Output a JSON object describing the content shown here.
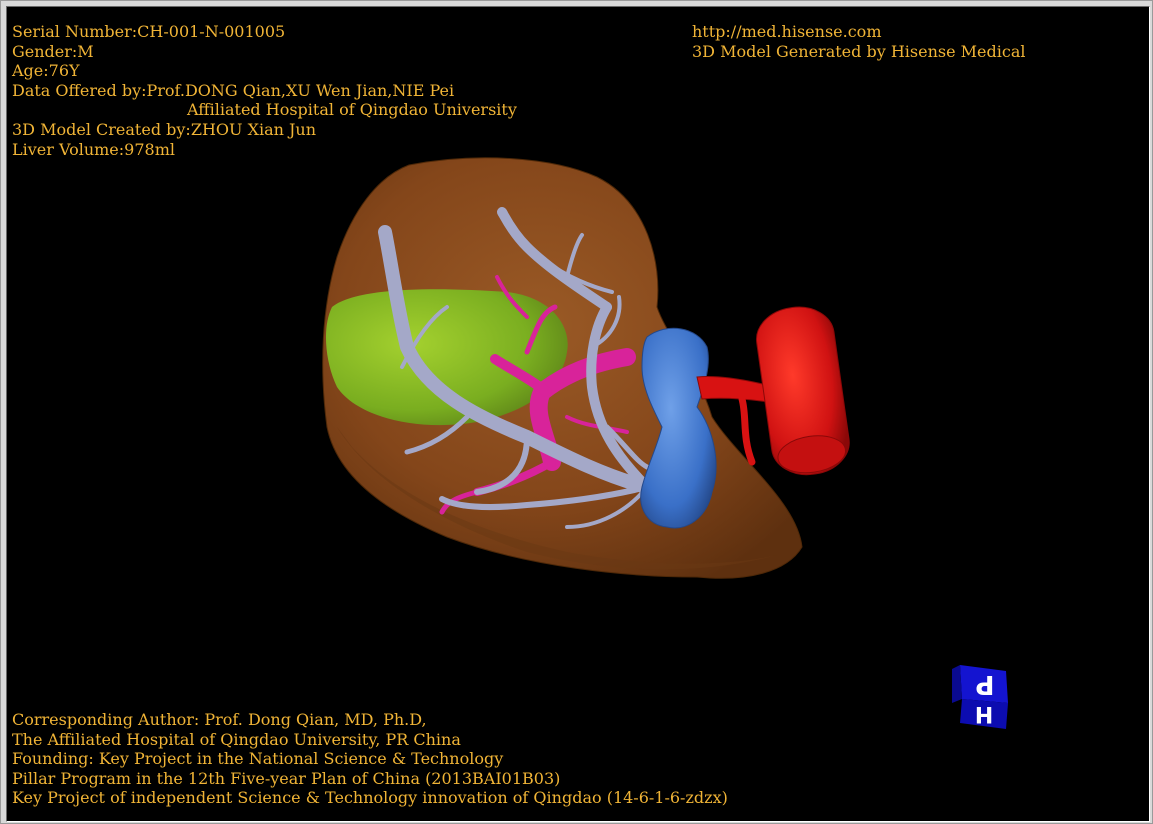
{
  "patient_info": {
    "serial_number": "Serial Number:CH-001-N-001005",
    "gender": "Gender:M",
    "age": "Age:76Y",
    "data_offered_by": "Data Offered by:Prof.DONG Qian,XU Wen Jian,NIE Pei",
    "hospital": "Affiliated Hospital of Qingdao University",
    "model_created_by": "3D Model Created by:ZHOU Xian Jun",
    "liver_volume": "Liver Volume:978ml"
  },
  "header_right": {
    "url": "http://med.hisense.com",
    "generator": "3D Model Generated by Hisense Medical"
  },
  "footer": {
    "corresponding_author": "Corresponding Author: Prof. Dong Qian, MD, Ph.D,",
    "affiliation": "The Affiliated Hospital of Qingdao University, PR China",
    "founding": "Founding: Key Project in the National Science & Technology",
    "pillar_program": "Pillar Program in the 12th Five-year Plan of China (2013BAI01B03)",
    "key_project": "Key Project of independent Science & Technology innovation of Qingdao (14-6-1-6-zdzx)"
  },
  "orientation_cube": {
    "top_label": "P",
    "front_label": "H",
    "color": "#1010c8"
  },
  "colors": {
    "text": "#f0b436",
    "background": "#000000",
    "liver": "#8a4a1c",
    "tumor": "#8ec82a",
    "hepatic_vein": "#a4a8c8",
    "portal_vein": "#d8239a",
    "ivc": "#d81212",
    "gallbladder": "#3a70c8"
  }
}
